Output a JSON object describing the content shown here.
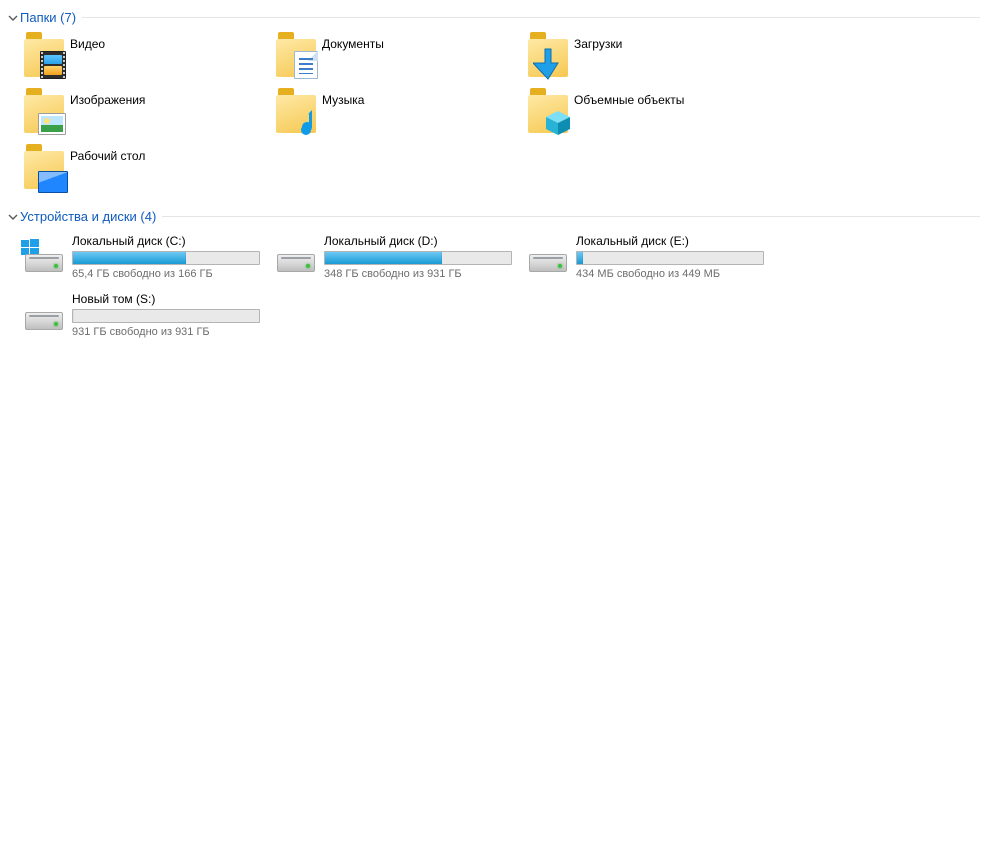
{
  "sections": {
    "folders": {
      "title": "Папки (7)",
      "items": [
        {
          "label": "Видео",
          "icon": "videos"
        },
        {
          "label": "Документы",
          "icon": "documents"
        },
        {
          "label": "Загрузки",
          "icon": "downloads"
        },
        {
          "label": "Изображения",
          "icon": "pictures"
        },
        {
          "label": "Музыка",
          "icon": "music"
        },
        {
          "label": "Объемные объекты",
          "icon": "objects3d"
        },
        {
          "label": "Рабочий стол",
          "icon": "desktop"
        }
      ]
    },
    "drives": {
      "title": "Устройства и диски (4)",
      "items": [
        {
          "name": "Локальный диск (C:)",
          "free_text": "65,4 ГБ свободно из 166 ГБ",
          "used_pct": 61,
          "os_drive": true
        },
        {
          "name": "Локальный диск (D:)",
          "free_text": "348 ГБ свободно из 931 ГБ",
          "used_pct": 63,
          "os_drive": false
        },
        {
          "name": "Локальный диск (E:)",
          "free_text": "434 МБ свободно из 449 МБ",
          "used_pct": 3,
          "os_drive": false
        },
        {
          "name": "Новый том (S:)",
          "free_text": "931 ГБ свободно из 931 ГБ",
          "used_pct": 0,
          "os_drive": false
        }
      ]
    }
  }
}
